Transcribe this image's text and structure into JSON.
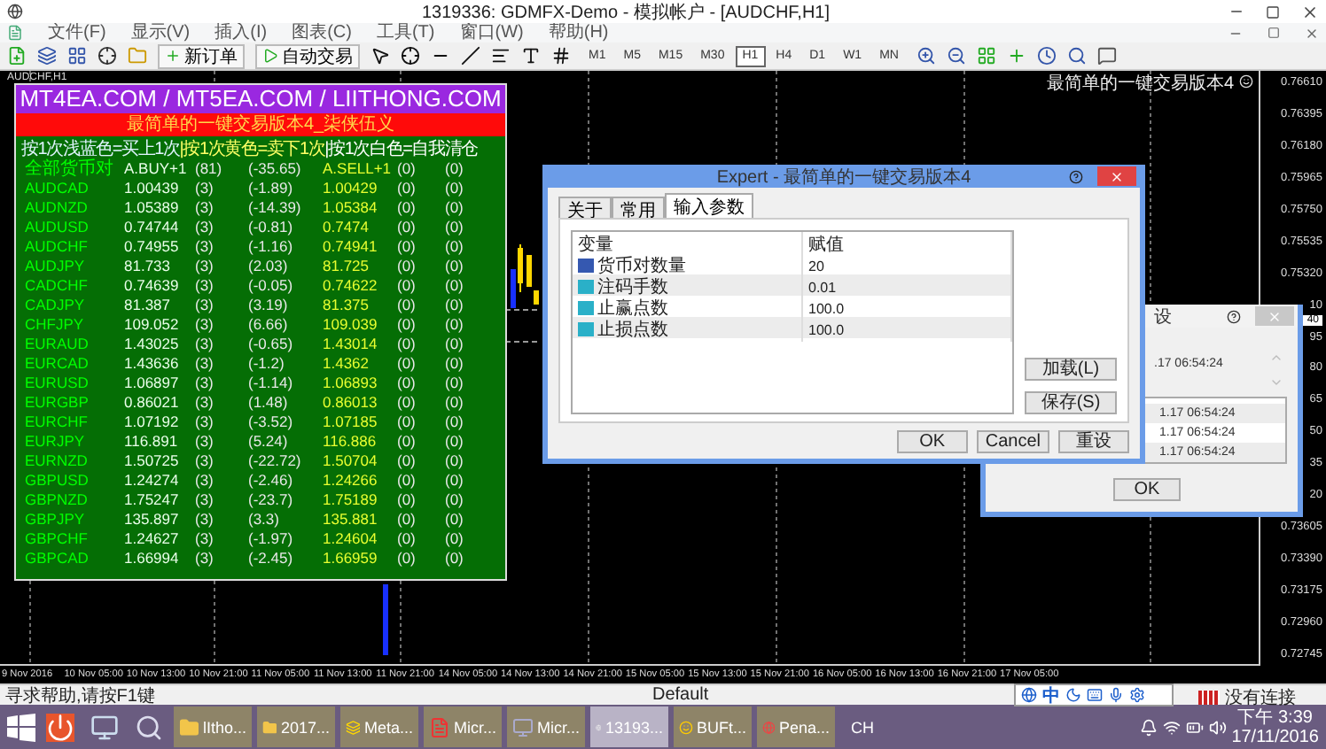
{
  "window": {
    "title": "1319336: GDMFX-Demo - 模拟帐户 - [AUDCHF,H1]"
  },
  "menu": [
    "文件(F)",
    "显示(V)",
    "插入(I)",
    "图表(C)",
    "工具(T)",
    "窗口(W)",
    "帮助(H)"
  ],
  "toolbar": {
    "buttons": [
      "新订单",
      "自动交易"
    ],
    "periods": [
      {
        "label": "M1",
        "selected": false
      },
      {
        "label": "M5",
        "selected": false
      },
      {
        "label": "M15",
        "selected": false
      },
      {
        "label": "M30",
        "selected": false
      },
      {
        "label": "H1",
        "selected": true
      },
      {
        "label": "H4",
        "selected": false
      },
      {
        "label": "D1",
        "selected": false
      },
      {
        "label": "W1",
        "selected": false
      },
      {
        "label": "MN",
        "selected": false
      }
    ]
  },
  "chart": {
    "label": "AUDCHF,H1",
    "ea_name": "最简单的一键交易版本4",
    "price_axis": [
      "0.76610",
      "0.76395",
      "0.76180",
      "0.75965",
      "0.75750",
      "0.75535",
      "0.75320",
      "10",
      "95",
      "80",
      "65",
      "50",
      "35",
      "20",
      "0.73605",
      "0.73390",
      "0.73175",
      "0.72960",
      "0.72745"
    ],
    "current_price": "40",
    "time_axis": [
      "9 Nov 2016",
      "10 Nov 05:00",
      "10 Nov 13:00",
      "10 Nov 21:00",
      "11 Nov 05:00",
      "11 Nov 13:00",
      "11 Nov 21:00",
      "14 Nov 05:00",
      "14 Nov 13:00",
      "14 Nov 21:00",
      "15 Nov 05:00",
      "15 Nov 13:00",
      "15 Nov 21:00",
      "16 Nov 05:00",
      "16 Nov 13:00",
      "16 Nov 21:00",
      "17 Nov 05:00"
    ]
  },
  "ea_panel": {
    "banner": "MT4EA.COM / MT5EA.COM / LIITHONG.COM",
    "title": "最简单的一键交易版本4_柒侠伍义",
    "instructions": [
      {
        "text": "按1次浅蓝色=买上1次",
        "color": "#e0f4ff"
      },
      {
        "text": "|按1次黄色=卖下1次",
        "color": "#ffff66"
      },
      {
        "text": "|按1次白色=自我清仓",
        "color": "#ffffff"
      }
    ],
    "header": [
      "全部货币对",
      "A.BUY+1",
      "(81)",
      "(-35.65)",
      "A.SELL+1",
      "(0)",
      "(0)"
    ],
    "rows": [
      [
        "AUDCAD",
        "1.00439",
        "(3)",
        "(-1.89)",
        "1.00429",
        "(0)",
        "(0)"
      ],
      [
        "AUDNZD",
        "1.05389",
        "(3)",
        "(-14.39)",
        "1.05384",
        "(0)",
        "(0)"
      ],
      [
        "AUDUSD",
        "0.74744",
        "(3)",
        "(-0.81)",
        "0.7474",
        "(0)",
        "(0)"
      ],
      [
        "AUDCHF",
        "0.74955",
        "(3)",
        "(-1.16)",
        "0.74941",
        "(0)",
        "(0)"
      ],
      [
        "AUDJPY",
        "81.733",
        "(3)",
        "(2.03)",
        "81.725",
        "(0)",
        "(0)"
      ],
      [
        "CADCHF",
        "0.74639",
        "(3)",
        "(-0.05)",
        "0.74622",
        "(0)",
        "(0)"
      ],
      [
        "CADJPY",
        "81.387",
        "(3)",
        "(3.19)",
        "81.375",
        "(0)",
        "(0)"
      ],
      [
        "CHFJPY",
        "109.052",
        "(3)",
        "(6.66)",
        "109.039",
        "(0)",
        "(0)"
      ],
      [
        "EURAUD",
        "1.43025",
        "(3)",
        "(-0.65)",
        "1.43014",
        "(0)",
        "(0)"
      ],
      [
        "EURCAD",
        "1.43636",
        "(3)",
        "(-1.2)",
        "1.4362",
        "(0)",
        "(0)"
      ],
      [
        "EURUSD",
        "1.06897",
        "(3)",
        "(-1.14)",
        "1.06893",
        "(0)",
        "(0)"
      ],
      [
        "EURGBP",
        "0.86021",
        "(3)",
        "(1.48)",
        "0.86013",
        "(0)",
        "(0)"
      ],
      [
        "EURCHF",
        "1.07192",
        "(3)",
        "(-3.52)",
        "1.07185",
        "(0)",
        "(0)"
      ],
      [
        "EURJPY",
        "116.891",
        "(3)",
        "(5.24)",
        "116.886",
        "(0)",
        "(0)"
      ],
      [
        "EURNZD",
        "1.50725",
        "(3)",
        "(-22.72)",
        "1.50704",
        "(0)",
        "(0)"
      ],
      [
        "GBPUSD",
        "1.24274",
        "(3)",
        "(-2.46)",
        "1.24266",
        "(0)",
        "(0)"
      ],
      [
        "GBPNZD",
        "1.75247",
        "(3)",
        "(-23.7)",
        "1.75189",
        "(0)",
        "(0)"
      ],
      [
        "GBPJPY",
        "135.897",
        "(3)",
        "(3.3)",
        "135.881",
        "(0)",
        "(0)"
      ],
      [
        "GBPCHF",
        "1.24627",
        "(3)",
        "(-1.97)",
        "1.24604",
        "(0)",
        "(0)"
      ],
      [
        "GBPCAD",
        "1.66994",
        "(3)",
        "(-2.45)",
        "1.66959",
        "(0)",
        "(0)"
      ]
    ]
  },
  "expert_dialog": {
    "title": "Expert - 最简单的一键交易版本4",
    "tabs": [
      {
        "label": "关于",
        "selected": false
      },
      {
        "label": "常用",
        "selected": false
      },
      {
        "label": "输入参数",
        "selected": true
      }
    ],
    "columns": [
      "变量",
      "赋值"
    ],
    "params": [
      {
        "name": "货币对数量",
        "value": "20",
        "kind": "integer"
      },
      {
        "name": "注码手数",
        "value": "0.01",
        "kind": "decimal"
      },
      {
        "name": "止赢点数",
        "value": "100.0",
        "kind": "decimal"
      },
      {
        "name": "止损点数",
        "value": "100.0",
        "kind": "decimal"
      }
    ],
    "side_buttons": [
      "加载(L)",
      "保存(S)"
    ],
    "buttons": [
      "OK",
      "Cancel",
      "重设"
    ]
  },
  "back_dialog": {
    "title": "设",
    "time": ".17 06:54:24",
    "list": [
      "1.17 06:54:24",
      "1.17 06:54:24",
      "1.17 06:54:24"
    ],
    "button": "OK"
  },
  "status_bar": {
    "help": "寻求帮助,请按F1键",
    "profile": "Default",
    "ime": "中",
    "connection": "没有连接"
  },
  "taskbar": {
    "items": [
      {
        "label": "lItho...",
        "selected": false
      },
      {
        "label": "2017...",
        "selected": false
      },
      {
        "label": "Meta...",
        "selected": false
      },
      {
        "label": "Micr...",
        "selected": false
      },
      {
        "label": "Micr...",
        "selected": false
      },
      {
        "label": "13193...",
        "selected": true
      },
      {
        "label": "BUFt...",
        "selected": false
      },
      {
        "label": "Pena...",
        "selected": false
      }
    ],
    "language": "CH",
    "time": "下午 3:39",
    "date": "17/11/2016"
  }
}
